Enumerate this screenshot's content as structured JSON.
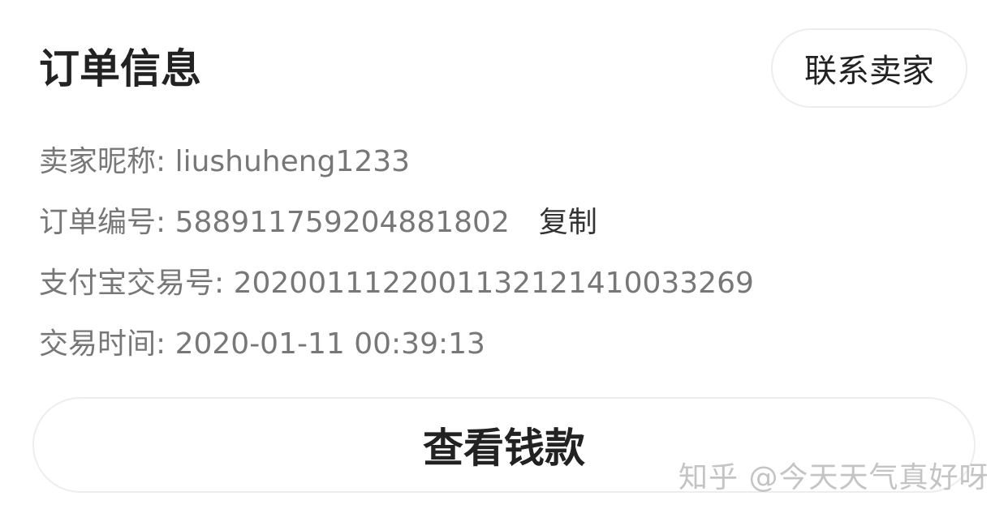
{
  "header": {
    "title": "订单信息",
    "contact_button": "联系卖家"
  },
  "details": {
    "seller_label": "卖家昵称: ",
    "seller_value": "liushuheng1233",
    "order_label": "订单编号: ",
    "order_value": "588911759204881802",
    "copy_label": "复制",
    "alipay_label": "支付宝交易号: ",
    "alipay_value": "2020011122001132121410033269",
    "time_label": "交易时间: ",
    "time_value": "2020-01-11 00:39:13"
  },
  "actions": {
    "view_payment": "查看钱款"
  },
  "watermark": "知乎 @今天天气真好呀"
}
